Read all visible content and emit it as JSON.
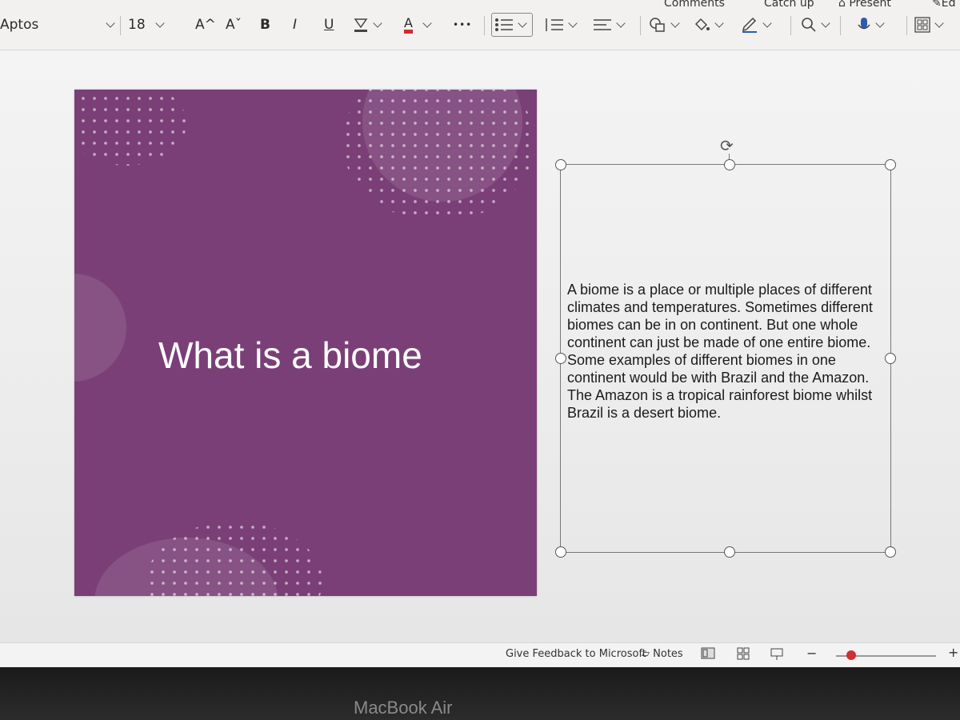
{
  "ribbon": {
    "font_name": "Aptos",
    "font_size": "18",
    "grow_font_label": "A^",
    "shrink_font_label": "Aˇ",
    "bold_label": "B",
    "italic_label": "I",
    "underline_label": "U",
    "font_color_label": "A",
    "more_label": "•••",
    "top_comments_label": "Comments",
    "top_catchup_label": "Catch up",
    "top_present_label": "Present",
    "top_edit_label": "Ed",
    "font_color_hex": "#d42a2a",
    "icons": [
      "highlighter-icon",
      "bullets-icon",
      "numbering-icon",
      "align-icon",
      "shapes-icon",
      "fill-icon",
      "designer-icon",
      "search-icon",
      "dictate-icon",
      "view-icon"
    ]
  },
  "slide": {
    "title": "What is a biome",
    "background_hex": "#7a3f77",
    "textbox_text": "A biome is a place or multiple places of different climates and temperatures. Sometimes different biomes can be in on continent. But one whole continent can just be made of one entire biome. Some examples of different biomes in one continent would be with Brazil and the Amazon. The Amazon is a tropical rainforest biome whilst Brazil is a desert biome."
  },
  "statusbar": {
    "feedback_label": "Give Feedback to Microsoft",
    "notes_label": "Notes",
    "zoom_level": 0.15
  },
  "device": {
    "label": "MacBook Air"
  }
}
